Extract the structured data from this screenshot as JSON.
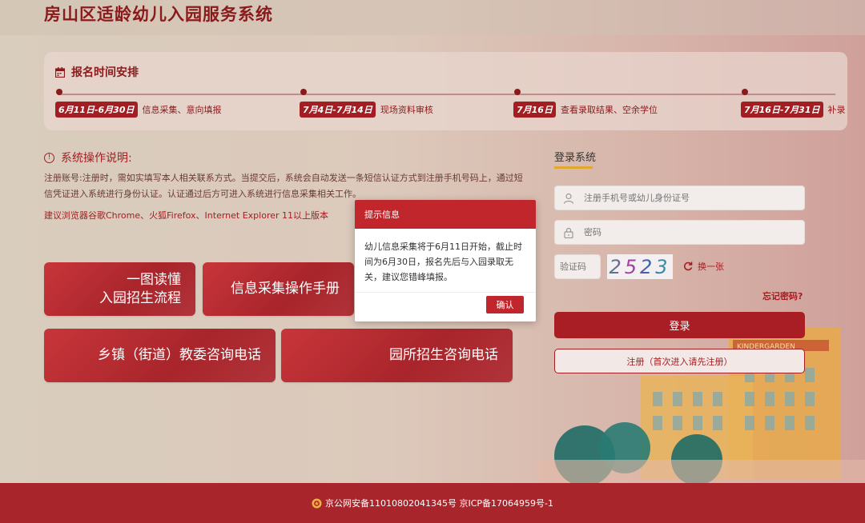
{
  "header": {
    "title": "房山区适龄幼儿入园服务系统"
  },
  "schedule": {
    "title": "报名时间安排",
    "items": [
      {
        "date": "6月11日-6月30日",
        "text": "信息采集、意向填报"
      },
      {
        "date": "7月4日-7月14日",
        "text": "现场资料审核"
      },
      {
        "date": "7月16日",
        "text": "查看录取结果、空余学位"
      },
      {
        "date": "7月16日-7月31日",
        "text": "补录"
      }
    ]
  },
  "instructions": {
    "title": "系统操作说明:",
    "body": "注册账号:注册时，需如实填写本人相关联系方式。当提交后，系统会自动发送一条短信认证方式到注册手机号码上，通过短信凭证进入系统进行身份认证。认证通过后方可进入系统进行信息采集相关工作。",
    "browser_note": "建议浏览器谷歌Chrome、火狐Firefox、Internet Explorer 11以上版本"
  },
  "tiles": {
    "flow_line1": "一图读懂",
    "flow_line2": "入园招生流程",
    "manual": "信息采集操作手册",
    "town_phone": "乡镇（街道）教委咨询电话",
    "kinder_phone": "园所招生咨询电话"
  },
  "login": {
    "title": "登录系统",
    "username_placeholder": "注册手机号或幼儿身份证号",
    "password_placeholder": "密码",
    "captcha_placeholder": "验证码",
    "captcha_text": "2523",
    "refresh_label": "换一张",
    "forgot_label": "忘记密码?",
    "login_label": "登录",
    "register_label": "注册（首次进入请先注册）"
  },
  "modal": {
    "title": "提示信息",
    "body": "幼儿信息采集将于6月11日开始，截止时间为6月30日，报名先后与入园录取无关，建议您错峰填报。",
    "ok_label": "确认"
  },
  "footer": {
    "text": "京公网安备11010802041345号 京ICP备17064959号-1"
  },
  "decoration": {
    "sign_text": "KINDERGARDEN"
  },
  "colors": {
    "primary": "#a8252b",
    "accent": "#e0a830"
  }
}
